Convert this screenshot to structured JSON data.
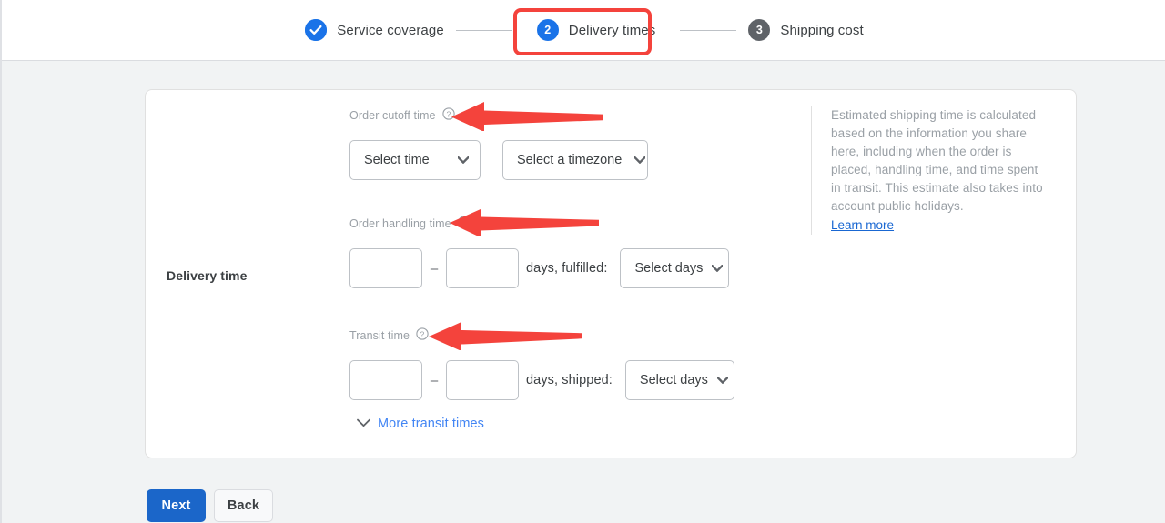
{
  "stepper": {
    "steps": [
      {
        "id": "service-coverage",
        "badge": "check",
        "label": "Service coverage",
        "state": "done"
      },
      {
        "id": "delivery-times",
        "badge": "2",
        "label": "Delivery times",
        "state": "active"
      },
      {
        "id": "shipping-cost",
        "badge": "3",
        "label": "Shipping cost",
        "state": "future"
      }
    ]
  },
  "card": {
    "section_label": "Delivery time",
    "order_cutoff": {
      "label": "Order cutoff time",
      "help_icon": "help-circle-icon",
      "time_select": "Select time",
      "timezone_select": "Select a timezone"
    },
    "order_handling": {
      "label": "Order handling time",
      "help_icon": "help-circle-icon",
      "min_value": "",
      "max_value": "",
      "min_placeholder": "",
      "max_placeholder": "",
      "dash": "–",
      "unit_text": "days, fulfilled:",
      "days_select": "Select days"
    },
    "transit": {
      "label": "Transit time",
      "help_icon": "help-circle-icon",
      "min_value": "",
      "max_value": "",
      "min_placeholder": "",
      "max_placeholder": "",
      "dash": "–",
      "unit_text": "days, shipped:",
      "days_select": "Select days"
    },
    "more_transit": {
      "icon": "chevron-down-icon",
      "label": "More transit times"
    },
    "info_panel": {
      "text": "Estimated shipping time is calculated based on the information you share here, including when the order is placed, handling time, and time spent in transit. This estimate also takes into account public holidays.",
      "link": "Learn more"
    }
  },
  "footer": {
    "next_label": "Next",
    "back_label": "Back"
  },
  "colors": {
    "accent_blue": "#1a73e8",
    "button_blue": "#1b66c9",
    "link_blue": "#4285f4",
    "annotation_red": "#f4433c",
    "page_bg": "#f1f3f4",
    "future_step_gray": "#5f6368"
  },
  "annotations": {
    "highlight_box": "red-rounded-rect-around-delivery-times-step",
    "arrows": [
      {
        "id": "arrow-order-cutoff",
        "points_to": "Order cutoff time"
      },
      {
        "id": "arrow-order-handling",
        "points_to": "Order handling time"
      },
      {
        "id": "arrow-transit-time",
        "points_to": "Transit time"
      }
    ]
  }
}
